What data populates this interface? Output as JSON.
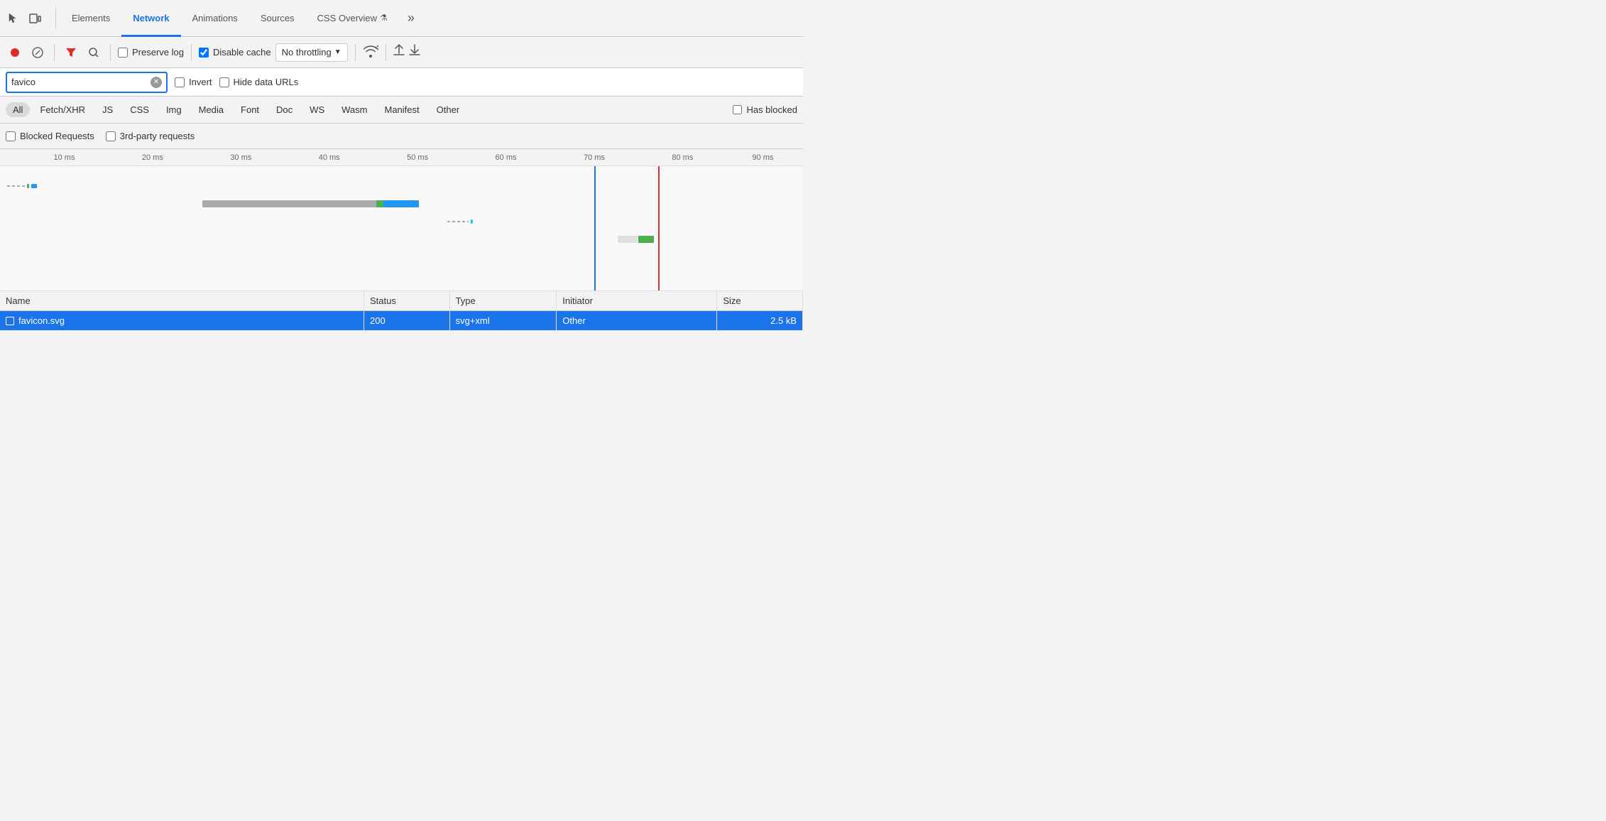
{
  "tabs": {
    "items": [
      {
        "label": "Elements",
        "active": false
      },
      {
        "label": "Network",
        "active": true
      },
      {
        "label": "Animations",
        "active": false
      },
      {
        "label": "Sources",
        "active": false
      },
      {
        "label": "CSS Overview",
        "active": false
      }
    ],
    "more_label": "»"
  },
  "toolbar": {
    "preserve_log_label": "Preserve log",
    "disable_cache_label": "Disable cache",
    "no_throttling_label": "No throttling",
    "preserve_log_checked": false,
    "disable_cache_checked": true
  },
  "filter": {
    "search_value": "favico",
    "search_placeholder": "Filter",
    "invert_label": "Invert",
    "hide_data_urls_label": "Hide data URLs",
    "invert_checked": false,
    "hide_data_checked": false
  },
  "type_filters": {
    "items": [
      {
        "label": "All",
        "active": true
      },
      {
        "label": "Fetch/XHR",
        "active": false
      },
      {
        "label": "JS",
        "active": false
      },
      {
        "label": "CSS",
        "active": false
      },
      {
        "label": "Img",
        "active": false
      },
      {
        "label": "Media",
        "active": false
      },
      {
        "label": "Font",
        "active": false
      },
      {
        "label": "Doc",
        "active": false
      },
      {
        "label": "WS",
        "active": false
      },
      {
        "label": "Wasm",
        "active": false
      },
      {
        "label": "Manifest",
        "active": false
      },
      {
        "label": "Other",
        "active": false
      }
    ],
    "has_blocked_label": "Has blocked"
  },
  "blocked_row": {
    "blocked_requests_label": "Blocked Requests",
    "third_party_label": "3rd-party requests"
  },
  "timeline": {
    "ruler_ticks": [
      {
        "label": "10 ms",
        "left_pct": 8
      },
      {
        "label": "20 ms",
        "left_pct": 19
      },
      {
        "label": "30 ms",
        "left_pct": 30
      },
      {
        "label": "40 ms",
        "left_pct": 41
      },
      {
        "label": "50 ms",
        "left_pct": 52
      },
      {
        "label": "60 ms",
        "left_pct": 63
      },
      {
        "label": "70 ms",
        "left_pct": 74
      },
      {
        "label": "80 ms",
        "left_pct": 85
      },
      {
        "label": "90 ms",
        "left_pct": 95
      }
    ]
  },
  "table": {
    "columns": [
      {
        "label": "Name",
        "key": "name"
      },
      {
        "label": "Status",
        "key": "status"
      },
      {
        "label": "Type",
        "key": "type"
      },
      {
        "label": "Initiator",
        "key": "initiator"
      },
      {
        "label": "Size",
        "key": "size"
      }
    ],
    "rows": [
      {
        "name": "favicon.svg",
        "status": "200",
        "type": "svg+xml",
        "initiator": "Other",
        "size": "2.5 kB",
        "selected": true
      }
    ]
  }
}
